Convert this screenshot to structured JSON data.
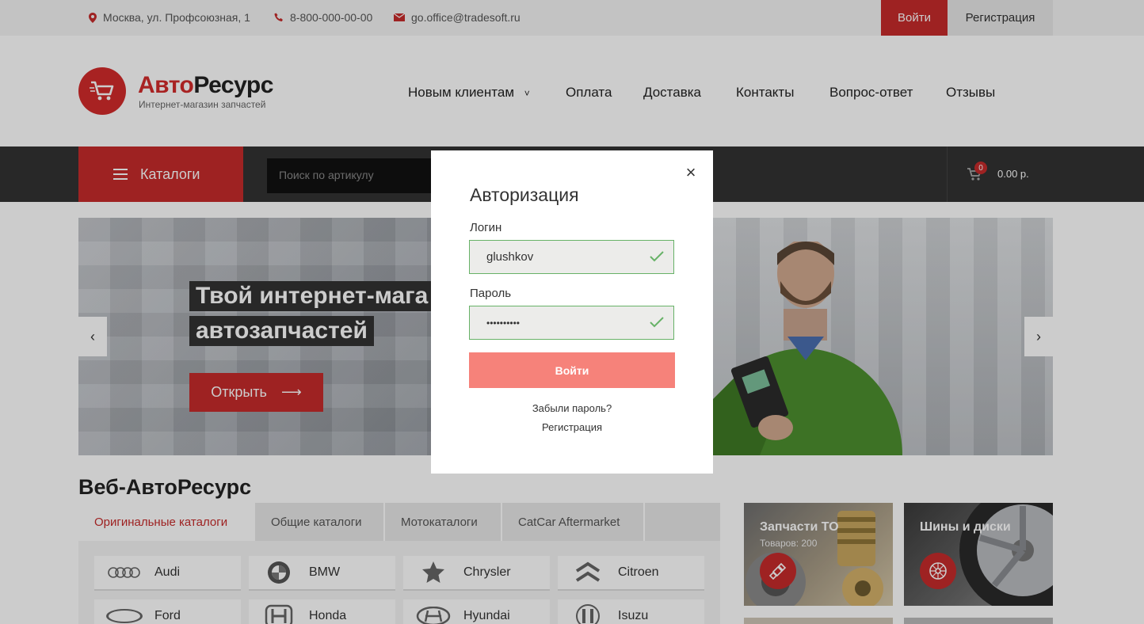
{
  "topbar": {
    "address": "Москва, ул. Профсоюзная, 1",
    "phone": "8-800-000-00-00",
    "email": "go.office@tradesoft.ru",
    "login_label": "Войти",
    "register_label": "Регистрация"
  },
  "logo": {
    "title_red": "Авто",
    "title_dark": "Ресурс",
    "subtitle": "Интернет-магазин запчастей"
  },
  "nav": {
    "items": [
      {
        "label": "Новым клиентам",
        "arrow": "˅"
      },
      {
        "label": "Оплата"
      },
      {
        "label": "Доставка"
      },
      {
        "label": "Контакты"
      },
      {
        "label": "Вопрос-ответ"
      },
      {
        "label": "Отзывы"
      }
    ]
  },
  "catalog_button": "Каталоги",
  "search": {
    "placeholder": "Поиск по артикулу"
  },
  "cart": {
    "count": "0",
    "total": "0.00 р."
  },
  "hero": {
    "title_line1": "Твой интернет-мага",
    "title_line2": "автозапчастей",
    "open_label": "Открыть",
    "arrow": "⟶",
    "prev": "‹",
    "next": "›"
  },
  "section": {
    "title": "Веб-АвтоРесурс",
    "tabs": [
      "Оригинальные каталоги",
      "Общие каталоги",
      "Мотокаталоги",
      "CatCar Aftermarket"
    ],
    "brands": [
      "Audi",
      "BMW",
      "Chrysler",
      "Citroen",
      "Ford",
      "Honda",
      "Hyundai",
      "Isuzu"
    ]
  },
  "promos": [
    {
      "title": "Запчасти ТО",
      "subtitle": "Товаров: 200"
    },
    {
      "title": "Шины и диски"
    }
  ],
  "modal": {
    "close": "×",
    "title": "Авторизация",
    "login_label": "Логин",
    "login_value": "glushkov",
    "password_label": "Пароль",
    "password_value": "••••••••••",
    "submit": "Войти",
    "forgot": "Забыли пароль?",
    "register": "Регистрация"
  },
  "colors": {
    "accent": "#c62b2b",
    "dark_bar": "#333333",
    "submit": "#f6827a",
    "valid": "#67b267"
  }
}
